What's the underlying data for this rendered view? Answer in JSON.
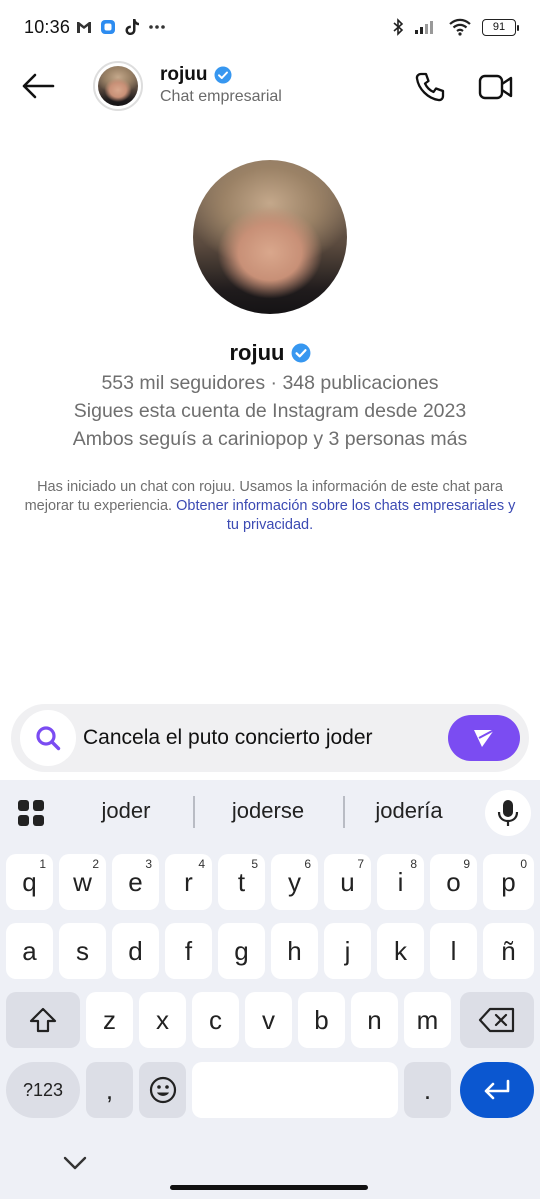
{
  "status_bar": {
    "time": "10:36",
    "battery": "91"
  },
  "header": {
    "name": "rojuu",
    "subtitle": "Chat empresarial"
  },
  "profile": {
    "name": "rojuu",
    "stats": "553 mil seguidores · 348 publicaciones",
    "following_since": "Sigues esta cuenta de Instagram desde 2023",
    "mutuals": "Ambos seguís a cariniopop y 3 personas más"
  },
  "notice": {
    "text": "Has iniciado un chat con rojuu. Usamos la información de este chat para mejorar tu experiencia.",
    "link": "Obtener información sobre los chats empresariales y tu privacidad."
  },
  "composer": {
    "value": "Cancela el puto concierto joder"
  },
  "colors": {
    "verified": "#3797f0",
    "send": "#7b4cf2",
    "link": "#3b4ab3",
    "enter": "#0b57d0"
  },
  "keyboard": {
    "suggestions": [
      "joder",
      "joderse",
      "jodería"
    ],
    "row1": [
      "q",
      "w",
      "e",
      "r",
      "t",
      "y",
      "u",
      "i",
      "o",
      "p"
    ],
    "row1_hints": [
      "1",
      "2",
      "3",
      "4",
      "5",
      "6",
      "7",
      "8",
      "9",
      "0"
    ],
    "row2": [
      "a",
      "s",
      "d",
      "f",
      "g",
      "h",
      "j",
      "k",
      "l",
      "ñ"
    ],
    "row3": [
      "z",
      "x",
      "c",
      "v",
      "b",
      "n",
      "m"
    ],
    "symbols_label": "?123",
    "comma": ",",
    "period": "."
  }
}
